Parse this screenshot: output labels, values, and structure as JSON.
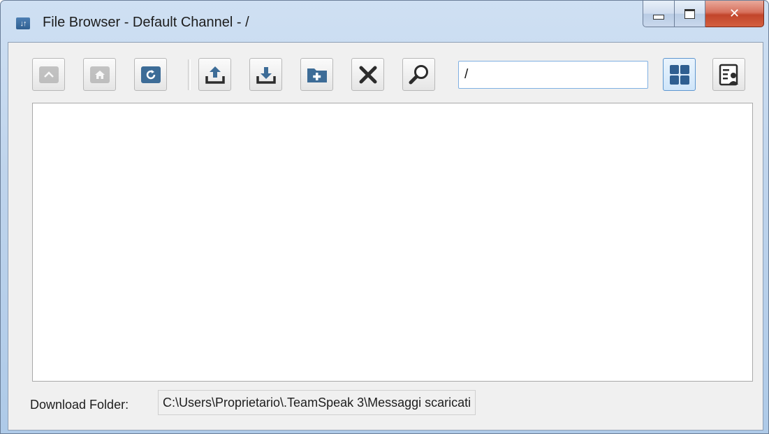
{
  "window": {
    "title": "File Browser - Default Channel - /",
    "icon": "file-browser-icon",
    "controls": {
      "minimize": "minimize-icon",
      "maximize": "maximize-icon",
      "close": "close-icon"
    }
  },
  "toolbar": {
    "buttons": [
      {
        "name": "parent-folder-button",
        "icon": "arrow-up-icon",
        "enabled": false
      },
      {
        "name": "home-button",
        "icon": "home-icon",
        "enabled": false
      },
      {
        "name": "refresh-button",
        "icon": "refresh-icon",
        "enabled": true
      },
      {
        "name": "upload-button",
        "icon": "upload-icon",
        "enabled": true
      },
      {
        "name": "download-button",
        "icon": "download-icon",
        "enabled": true
      },
      {
        "name": "new-folder-button",
        "icon": "new-folder-icon",
        "enabled": true
      },
      {
        "name": "delete-button",
        "icon": "delete-icon",
        "enabled": true
      },
      {
        "name": "search-button",
        "icon": "search-icon",
        "enabled": true
      },
      {
        "name": "icon-view-button",
        "icon": "grid-view-icon",
        "enabled": true
      },
      {
        "name": "detail-view-button",
        "icon": "detail-view-icon",
        "enabled": true
      }
    ],
    "path_value": "/"
  },
  "files": [],
  "footer": {
    "label": "Download Folder:",
    "path": "C:\\Users\\Proprietario\\.TeamSpeak 3\\Messaggi scaricati"
  },
  "colors": {
    "accent": "#3d6c97",
    "disabled": "#9a9a9a",
    "close_button": "#c2452b"
  }
}
